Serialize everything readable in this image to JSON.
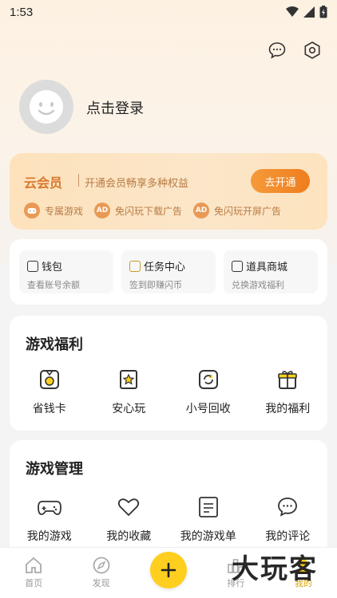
{
  "status": {
    "time": "1:53"
  },
  "profile": {
    "login_label": "点击登录"
  },
  "vip": {
    "title": "云会员",
    "description": "开通会员畅享多种权益",
    "button": "去开通",
    "perks": [
      "专属游戏",
      "免闪玩下载广告",
      "免闪玩开屏广告"
    ]
  },
  "wallet": [
    {
      "title": "钱包",
      "subtitle": "查看账号余额"
    },
    {
      "title": "任务中心",
      "subtitle": "签到即赚闪币"
    },
    {
      "title": "道具商城",
      "subtitle": "兑换游戏福利"
    }
  ],
  "benefits": {
    "title": "游戏福利",
    "items": [
      "省钱卡",
      "安心玩",
      "小号回收",
      "我的福利"
    ]
  },
  "management": {
    "title": "游戏管理",
    "items": [
      "我的游戏",
      "我的收藏",
      "我的游戏单",
      "我的评论"
    ]
  },
  "tabs": [
    "首页",
    "发现",
    "排行",
    "我的"
  ],
  "watermark": "大玩客",
  "colors": {
    "accent": "#ffcf1f",
    "vip_orange": "#ef7d1e"
  }
}
